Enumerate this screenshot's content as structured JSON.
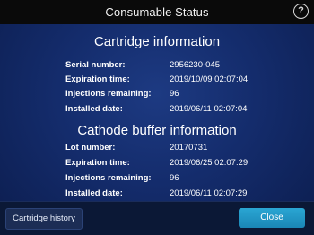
{
  "header": {
    "title": "Consumable Status",
    "help_label": "?"
  },
  "cartridge": {
    "title": "Cartridge information",
    "rows": [
      {
        "label": "Serial number:",
        "value": "2956230-045"
      },
      {
        "label": "Expiration time:",
        "value": "2019/10/09 02:07:04"
      },
      {
        "label": "Injections remaining:",
        "value": "96"
      },
      {
        "label": "Installed date:",
        "value": "2019/06/11 02:07:04"
      }
    ]
  },
  "cathode": {
    "title": "Cathode buffer information",
    "rows": [
      {
        "label": "Lot number:",
        "value": "20170731"
      },
      {
        "label": "Expiration time:",
        "value": "2019/06/25 02:07:29"
      },
      {
        "label": "Injections remaining:",
        "value": "96"
      },
      {
        "label": "Installed date:",
        "value": "2019/06/11 02:07:29"
      }
    ]
  },
  "footer": {
    "history_label": "Cartridge history",
    "close_label": "Close"
  },
  "colors": {
    "accent": "#1f96c6",
    "background": "#142c6c",
    "title_bar": "#0a0a0a"
  },
  "icons": {
    "help": "question-circle-icon"
  }
}
